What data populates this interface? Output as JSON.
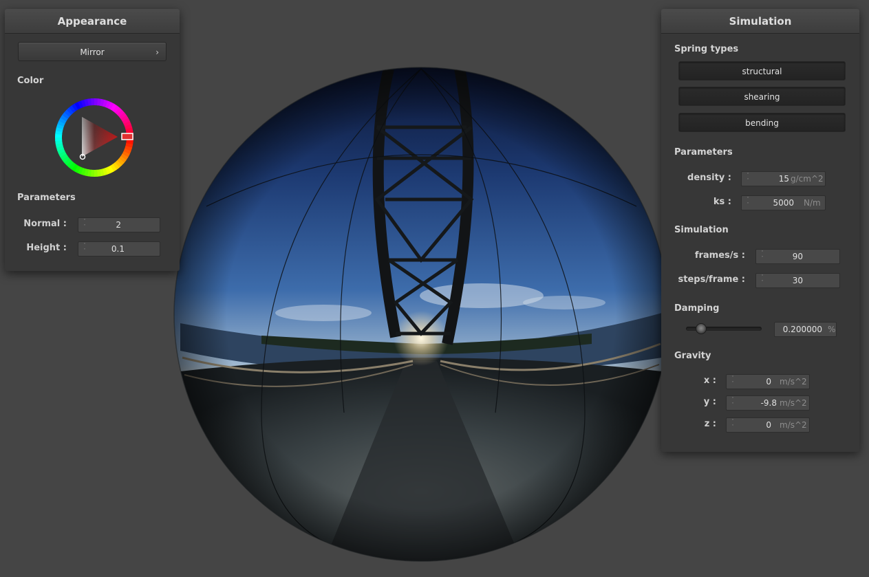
{
  "colors": {
    "background": "#454545",
    "panel": "#373737",
    "wheel_marker": "#e03030",
    "triangle_color": "#d82a2a"
  },
  "appearance": {
    "title": "Appearance",
    "material_button": "Mirror",
    "material_chevron": "›",
    "color_label": "Color",
    "parameters_label": "Parameters",
    "normal_label": "Normal :",
    "normal_value": "2",
    "height_label": "Height :",
    "height_value": "0.1"
  },
  "simulation": {
    "title": "Simulation",
    "spring_types_label": "Spring types",
    "spring_types": [
      "structural",
      "shearing",
      "bending"
    ],
    "parameters_label": "Parameters",
    "density_label": "density :",
    "density_value": "15",
    "density_unit": "g/cm^2",
    "ks_label": "ks :",
    "ks_value": "5000",
    "ks_unit": "N/m",
    "simulation_label": "Simulation",
    "fps_label": "frames/s :",
    "fps_value": "90",
    "steps_label": "steps/frame :",
    "steps_value": "30",
    "damping_label": "Damping",
    "damping_value": "0.200000",
    "damping_unit": "%",
    "damping_slider_fraction": 0.2,
    "gravity_label": "Gravity",
    "gx_label": "x :",
    "gx_value": "0",
    "gy_label": "y :",
    "gy_value": "-9.8",
    "gz_label": "z :",
    "gz_value": "0",
    "gravity_unit": "m/s^2"
  },
  "icons": {
    "spinner": "up-down-arrows-icon",
    "chevron": "chevron-right-icon"
  }
}
